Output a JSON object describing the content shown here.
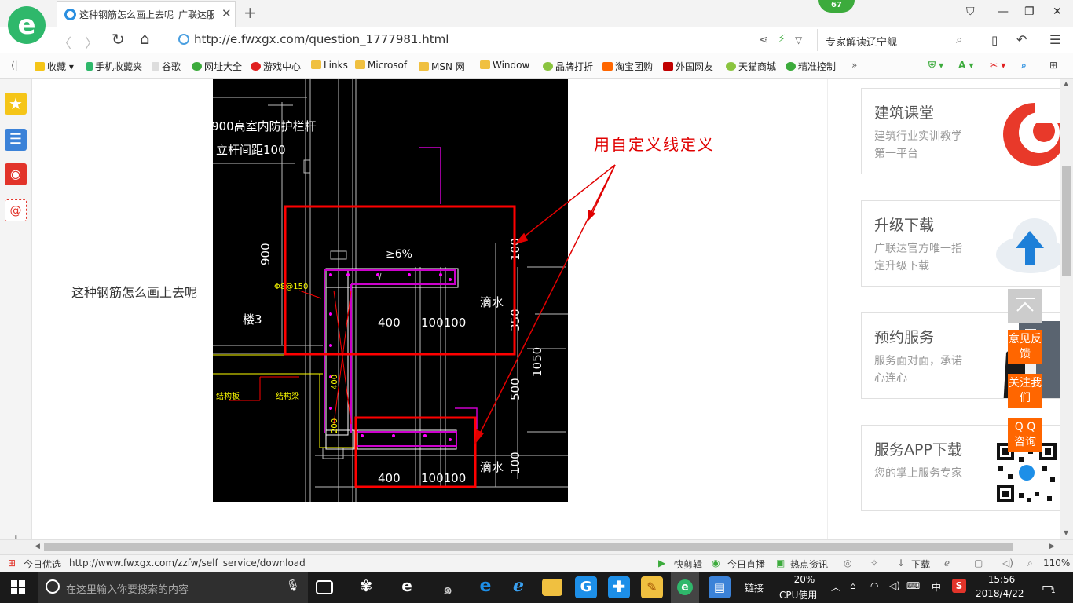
{
  "browser": {
    "tab_title": "这种钢筋怎么画上去呢_广联达服",
    "badge_count": "67",
    "url": "http://e.fwxgx.com/question_1777981.html",
    "search_text": "专家解读辽宁舰"
  },
  "bookmarks": [
    {
      "label": "收藏",
      "color": "#f5c518"
    },
    {
      "label": "手机收藏夹",
      "color": "#2fb86b"
    },
    {
      "label": "谷歌",
      "color": "#bbbbbb"
    },
    {
      "label": "网址大全",
      "color": "#3cab3c"
    },
    {
      "label": "游戏中心",
      "color": "#e02020"
    },
    {
      "label": "Links",
      "color": "#f0c040"
    },
    {
      "label": "Microsof",
      "color": "#f0c040"
    },
    {
      "label": "MSN 网",
      "color": "#f0c040"
    },
    {
      "label": "Window",
      "color": "#f0c040"
    },
    {
      "label": "品牌打折",
      "color": "#8ac43f"
    },
    {
      "label": "淘宝团购",
      "color": "#ff6600"
    },
    {
      "label": "外国网友",
      "color": "#c00000"
    },
    {
      "label": "天猫商城",
      "color": "#8ac43f"
    },
    {
      "label": "精准控制",
      "color": "#3cab3c"
    }
  ],
  "content": {
    "question_text": "这种钢筋怎么画上去呢",
    "annotation": "用自定义线定义",
    "cad": {
      "note1": "900高室内防护栏杆",
      "note2": "立杆间距100",
      "dim900": "900",
      "slope": "≥6%",
      "rebar": "Φ8@150",
      "dim400a": "400",
      "dim100a": "100100",
      "drip1": "滴水",
      "dim100r": "100",
      "dim350": "350",
      "dim1050": "1050",
      "dim500": "500",
      "floor": "楼3",
      "beam1": "结构板",
      "beam2": "结构梁",
      "dim400v": "400",
      "dim200v": "200",
      "dim400b": "400",
      "dim100b": "100100",
      "drip2": "滴水",
      "dim100b2": "100"
    }
  },
  "cards": [
    {
      "title": "建筑课堂",
      "desc": "建筑行业实训教学第一平台"
    },
    {
      "title": "升级下载",
      "desc": "广联达官方唯一指定升级下载"
    },
    {
      "title": "预约服务",
      "desc": "服务面对面，承诺心连心"
    },
    {
      "title": "服务APP下载",
      "desc": "您的掌上服务专家"
    }
  ],
  "float_buttons": [
    "意见反馈",
    "关注我们",
    "Q Q 咨询"
  ],
  "status": {
    "today": "今日优选",
    "link": "http://www.fwxgx.com/zzfw/self_service/download",
    "kuaijianji": "快剪辑",
    "zhibo": "今日直播",
    "zixun": "热点资讯",
    "download": "下载",
    "zoom": "110%"
  },
  "taskbar": {
    "search_placeholder": "在这里输入你要搜索的内容",
    "link": "链接",
    "cpu_percent": "20%",
    "cpu_label": "CPU使用",
    "ime": "中",
    "time": "15:56",
    "date": "2018/4/22",
    "notif": "1"
  }
}
